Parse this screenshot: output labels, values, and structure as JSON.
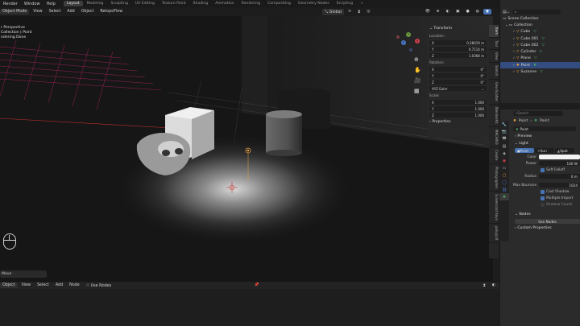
{
  "topbar": {
    "menus": [
      "Render",
      "Window",
      "Help"
    ],
    "workspaces": [
      "Layout",
      "Modeling",
      "Sculpting",
      "UV Editing",
      "Texture Paint",
      "Shading",
      "Animation",
      "Rendering",
      "Compositing",
      "Geometry Nodes",
      "Scripting"
    ],
    "active_workspace": "Layout",
    "add_tab": "+",
    "scene_label": "Scene",
    "viewlayer_label": "ViewL"
  },
  "viewport_header": {
    "mode": "Object Mode",
    "menus": [
      "View",
      "Select",
      "Add",
      "Object"
    ],
    "addon": "RetopoFlow",
    "orientation": "Global",
    "options": "Options"
  },
  "overlay": {
    "line1": "r Perspective",
    "line2": "Collection | Point",
    "line3": "ndering Done"
  },
  "npanel": {
    "transform_title": "Transform",
    "location_label": "Location:",
    "location": [
      {
        "axis": "X",
        "value": "0.28419 m"
      },
      {
        "axis": "Y",
        "value": "0.7114 m"
      },
      {
        "axis": "Z",
        "value": "1.0368 m"
      }
    ],
    "rotation_label": "Rotation:",
    "rotation": [
      {
        "axis": "X",
        "value": "0°"
      },
      {
        "axis": "Y",
        "value": "0°"
      },
      {
        "axis": "Z",
        "value": "0°"
      }
    ],
    "rotation_mode": "XYZ Euler",
    "scale_label": "Scale:",
    "scale": [
      {
        "axis": "X",
        "value": "1.000"
      },
      {
        "axis": "Y",
        "value": "1.000"
      },
      {
        "axis": "Z",
        "value": "1.000"
      }
    ],
    "properties_title": "Properties"
  },
  "side_tabs": [
    "Item",
    "Tool",
    "View",
    "Sketch",
    "Geo-Scatter",
    "BlenderKit",
    "MACHIN3",
    "Create",
    "Photographer",
    "Screencast Keys",
    "polyquilt"
  ],
  "status_move": "Move",
  "outliner": {
    "search_placeholder": "",
    "scene_collection": "Scene Collection",
    "collection": "Collection",
    "items": [
      "Cube",
      "Cube.001",
      "Cube.002",
      "Cylinder",
      "Plane",
      "Point",
      "Suzanne"
    ],
    "selected": "Point"
  },
  "properties": {
    "search_placeholder": "Search",
    "breadcrumb_obj": "Point",
    "breadcrumb_data": "Point",
    "datablock": "Point",
    "preview": "Preview",
    "light": "Light",
    "light_types": [
      "Point",
      "Sun",
      "Spot"
    ],
    "color_label": "Color",
    "power_label": "Power",
    "power_value": "100 W",
    "soft_falloff": "Soft Falloff",
    "radius_label": "Radius",
    "radius_value": "0 m",
    "max_bounces_label": "Max Bounces",
    "max_bounces_value": "1024",
    "cast_shadow": "Cast Shadow",
    "multiple_importance": "Multiple Import",
    "shadow_caustics": "Shadow Causti",
    "nodes": "Nodes",
    "use_nodes": "Use Nodes",
    "custom_properties": "Custom Properties"
  },
  "bottom_header": {
    "mode": "Object",
    "menus": [
      "View",
      "Select",
      "Add",
      "Node"
    ],
    "use_nodes": "Use Nodes"
  },
  "colors": {
    "accent": "#4772b3",
    "selection": "#334d80",
    "light_orange": "#e8a040"
  }
}
